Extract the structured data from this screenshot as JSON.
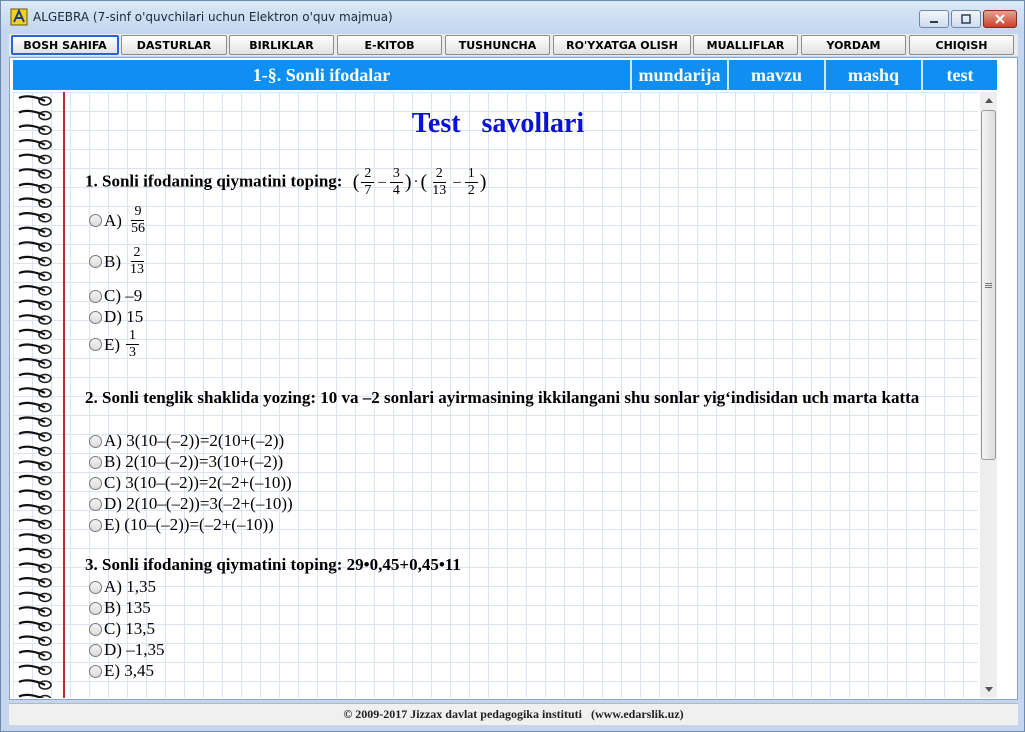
{
  "window": {
    "title": "ALGEBRA (7-sinf o'quvchilari uchun Elektron o'quv majmua)"
  },
  "nav": [
    {
      "label": "BOSH SAHIFA"
    },
    {
      "label": "DASTURLAR"
    },
    {
      "label": "BIRLIKLAR"
    },
    {
      "label": "E-KITOB"
    },
    {
      "label": "TUSHUNCHA"
    },
    {
      "label": "RO'YXATGA OLISH"
    },
    {
      "label": "MUALLIFLAR"
    },
    {
      "label": "YORDAM"
    },
    {
      "label": "CHIQISH"
    }
  ],
  "header": {
    "title": "1-§. Sonli ifodalar",
    "links": [
      "mundarija",
      "mavzu",
      "mashq",
      "test"
    ]
  },
  "test": {
    "title": "Test   savollari",
    "questions": [
      {
        "text": "1. Sonli ifodaning qiymatini toping:",
        "expr": {
          "f1": [
            "2",
            "7"
          ],
          "f2": [
            "3",
            "4"
          ],
          "f3": [
            "2",
            "13"
          ],
          "f4": [
            "1",
            "2"
          ],
          "minus": "–",
          "dot": "·",
          "open": "(",
          "close": ")"
        },
        "options": [
          {
            "letter": "A)",
            "frac": [
              "9",
              "56"
            ]
          },
          {
            "letter": "B)",
            "frac": [
              "2",
              "13"
            ]
          },
          {
            "letter": "C)",
            "value": "–9"
          },
          {
            "letter": "D)",
            "value": "15"
          },
          {
            "letter": "E)",
            "frac": [
              "1",
              "3"
            ]
          }
        ]
      },
      {
        "text": "2. Sonli tenglik shaklida yozing: 10 va –2 sonlari ayirmasining ikkilangani shu sonlar yig‘indisidan uch marta katta",
        "options": [
          {
            "letter": "A)",
            "value": "3(10–(–2))=2(10+(–2))"
          },
          {
            "letter": "B)",
            "value": "2(10–(–2))=3(10+(–2))"
          },
          {
            "letter": "C)",
            "value": "3(10–(–2))=2(–2+(–10))"
          },
          {
            "letter": "D)",
            "value": "2(10–(–2))=3(–2+(–10))"
          },
          {
            "letter": "E)",
            "value": "(10–(–2))=(–2+(–10))"
          }
        ]
      },
      {
        "text": "3. Sonli ifodaning qiymatini toping: 29•0,45+0,45•11",
        "options": [
          {
            "letter": "A)",
            "value": "1,35"
          },
          {
            "letter": "B)",
            "value": "135"
          },
          {
            "letter": "C)",
            "value": "13,5"
          },
          {
            "letter": "D)",
            "value": "–1,35"
          },
          {
            "letter": "E)",
            "value": "3,45"
          }
        ]
      }
    ]
  },
  "status": {
    "text": "© 2009-2017 Jizzax davlat pedagogika instituti   (www.edarslik.uz)"
  },
  "colors": {
    "header_bg": "#0f8ff2",
    "title_blue": "#0a12d8",
    "margin_red": "#b03030"
  }
}
